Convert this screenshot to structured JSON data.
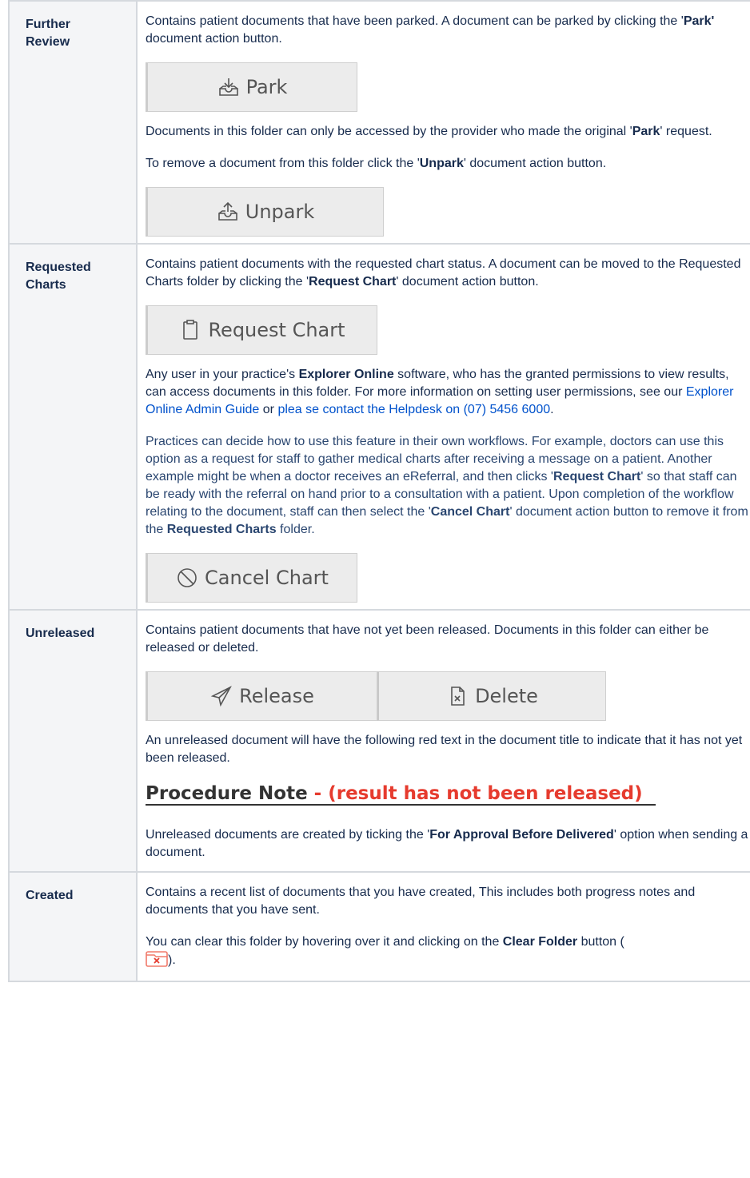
{
  "rows": [
    {
      "key": "Further\nReview",
      "p1_a": "Contains patient documents that have been parked. A document can be parked by clicking the '",
      "p1_b": "Park'",
      "p1_c": " document action button.",
      "btn_park": "Park",
      "p2_a": "Documents in this folder can only be accessed by the provider who made the original '",
      "p2_b": "Park",
      "p2_c": "' request.",
      "p3_a": "To remove a document from this folder click the '",
      "p3_b": "Unpark",
      "p3_c": "' document action button.",
      "btn_unpark": "Unpark"
    },
    {
      "key": "Requested\nCharts",
      "p1_a": "Contains patient documents with the requested chart status. A document can be moved to the Requested Charts folder by clicking the '",
      "p1_b": "Request Chart",
      "p1_c": "' document action button.",
      "btn_request": "Request Chart",
      "p2_a": "Any user in your practice's ",
      "p2_b": "Explorer Online",
      "p2_c": " software, who has the granted permissions to view results, can access documents in this folder. For more information on setting user permissions, see our ",
      "p2_link1": "Explorer Online Admin Guide",
      "p2_d": " or ",
      "p2_link2": "plea se contact the Helpdesk on (07) 5456 6000",
      "p2_e": ".",
      "p3_a": "Practices can decide how to use this feature in their own workflows. For example, doctors can use this option as a request for staff to gather medical charts after receiving a message on a patient. Another example might be when a doctor receives an eReferral, and then clicks '",
      "p3_b": "Request Chart",
      "p3_c": "' so that staff can be ready with the referral on hand prior to a consultation with a patient. Upon completion of the workflow relating to the document, staff can then select the '",
      "p3_d": "Cancel Chart",
      "p3_e": "' document action button to remove it from the ",
      "p3_f": "Requested Charts",
      "p3_g": " folder.",
      "btn_cancel": "Cancel Chart"
    },
    {
      "key": "Unreleased",
      "p1": "Contains patient documents that have not yet been released. Documents in this folder can either be released or deleted.",
      "btn_release": "Release",
      "btn_delete": "Delete",
      "p2": "An unreleased document will have the following red text in the document title to indicate that it has not yet been released.",
      "proc_title": "Procedure Note",
      "proc_red": " - (result has not been released)",
      "p3_a": "Unreleased documents are created by ticking the '",
      "p3_b": "For Approval Before Delivered",
      "p3_c": "' option when sending a document."
    },
    {
      "key": "Created",
      "p1": "Contains a recent list of documents that you have created, This includes both progress notes and documents that you have sent.",
      "p2_a": "You can clear this folder by hovering over it and clicking on the ",
      "p2_b": "Clear Folder",
      "p2_c": " button (",
      "p2_d": ")."
    }
  ]
}
